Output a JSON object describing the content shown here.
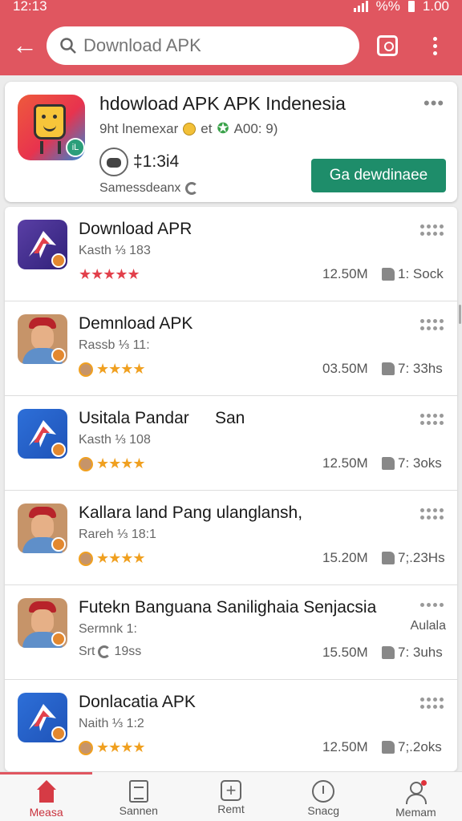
{
  "status_bar": {
    "time": "12:13",
    "battery": "1.00",
    "signal_text": "%%"
  },
  "header": {
    "search_placeholder": "Download APK"
  },
  "featured": {
    "title": "hdowload APK APK Indenesia",
    "subtitle_left": "9ht lnemexar",
    "subtitle_mid": "et",
    "subtitle_right": "A00: 9)",
    "count": "‡1:3i4",
    "developer": "Samessdeanx",
    "get_button": "Ga dewdinaee"
  },
  "apps": [
    {
      "name": "Download APR",
      "sub": "Kasth ⅓ 183",
      "size": "12.50M",
      "likes": "1: Sock",
      "icon": "arrow-purple"
    },
    {
      "name": "Demnload APK",
      "sub": "Rassb ⅓ 11:",
      "size": "03.50M",
      "likes": "7: 33hs",
      "icon": "face"
    },
    {
      "name": "Usitala Pandar",
      "name_suffix": "San",
      "sub": "Kasth ⅓ 108",
      "size": "12.50M",
      "likes": "7: 3oks",
      "icon": "arrow-blue"
    },
    {
      "name": "Kallara land Pang ulanglansh,",
      "sub": "Rareh ⅓ 18:1",
      "size": "15.20M",
      "likes": "7;.23Hs",
      "icon": "face"
    },
    {
      "name": "Futekn Banguana Sanilighaia Senjacsia",
      "sub": "Sermnk 1:",
      "rating_text": "Srt",
      "rating_suffix": "19ss",
      "extra": "Aulala",
      "size": "15.50M",
      "likes": "7: 3uhs",
      "icon": "face"
    },
    {
      "name": "Donlacatia APK",
      "sub": "Naith ⅓ 1:2",
      "size": "12.50M",
      "likes": "7;.2oks",
      "icon": "arrow-blue"
    }
  ],
  "bottom_nav": [
    {
      "label": "Measa",
      "icon": "home-icon",
      "active": true
    },
    {
      "label": "Sannen",
      "icon": "document-icon"
    },
    {
      "label": "Remt",
      "icon": "add-icon"
    },
    {
      "label": "Snacg",
      "icon": "clock-icon"
    },
    {
      "label": "Memam",
      "icon": "user-icon"
    }
  ],
  "colors": {
    "brand": "#e05660",
    "get_button": "#1e8d6a",
    "star": "#e2404b",
    "star_gold": "#f0a020"
  }
}
